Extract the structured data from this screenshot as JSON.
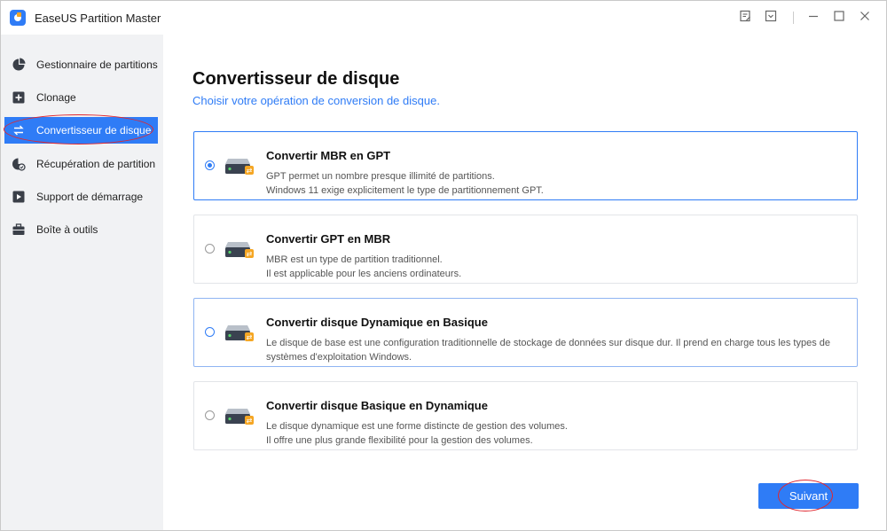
{
  "window": {
    "title": "EaseUS Partition Master",
    "controls": [
      "feedback-icon",
      "menu-icon",
      "minimize-icon",
      "maximize-icon",
      "close-icon"
    ]
  },
  "sidebar": {
    "items": [
      {
        "label": "Gestionnaire de partitions",
        "icon": "pie-chart-icon"
      },
      {
        "label": "Clonage",
        "icon": "clone-icon"
      },
      {
        "label": "Convertisseur de disque",
        "icon": "convert-icon",
        "active": true
      },
      {
        "label": "Récupération de partition",
        "icon": "partition-recovery-icon"
      },
      {
        "label": "Support de démarrage",
        "icon": "bootable-media-icon"
      },
      {
        "label": "Boîte à outils",
        "icon": "toolbox-icon"
      }
    ]
  },
  "main": {
    "title": "Convertisseur de disque",
    "subtitle": "Choisir votre opération de conversion de disque.",
    "options": [
      {
        "title": "Convertir MBR en GPT",
        "line1": "GPT permet un nombre presque illimité de partitions.",
        "line2": "Windows 11 exige explicitement le type de partitionnement GPT.",
        "selected": true
      },
      {
        "title": "Convertir GPT en MBR",
        "line1": "MBR est un type de partition traditionnel.",
        "line2": "Il est applicable pour les anciens ordinateurs.",
        "selected": false
      },
      {
        "title": "Convertir disque Dynamique en Basique",
        "line1": "Le disque de base est une configuration traditionnelle de stockage de données sur disque dur. Il prend en charge tous les types de",
        "line2": "systèmes d'exploitation Windows.",
        "selected": false
      },
      {
        "title": "Convertir disque Basique en Dynamique",
        "line1": "Le disque dynamique est une forme distincte de gestion des volumes.",
        "line2": "Il offre une plus grande flexibilité pour la gestion des volumes.",
        "selected": false
      }
    ],
    "next_label": "Suivant"
  },
  "colors": {
    "accent": "#2f7cf6",
    "sidebar_bg": "#f1f2f4",
    "highlight_ring": "#e0272f",
    "disk_badge": "#f5a623"
  }
}
